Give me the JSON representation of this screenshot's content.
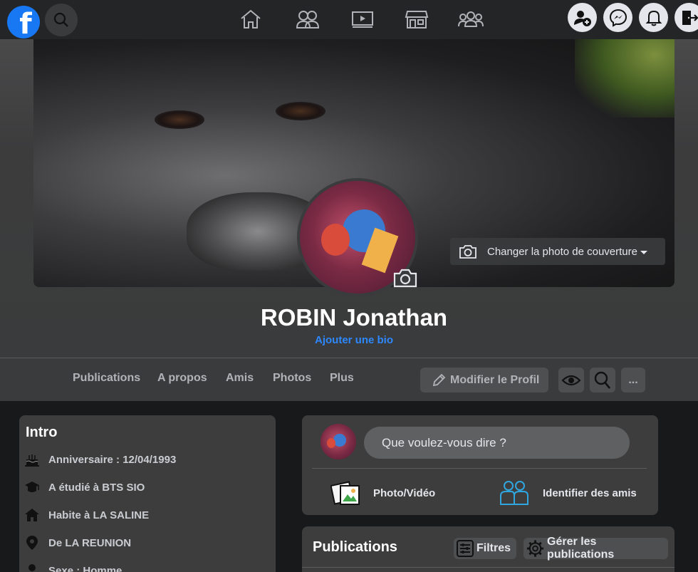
{
  "nav": {
    "logo_letter": "f",
    "icons": [
      "home-icon",
      "friends-icon",
      "watch-icon",
      "marketplace-icon",
      "groups-icon"
    ],
    "right_icons": [
      "add-friend-icon",
      "messenger-icon",
      "notifications-icon",
      "logout-icon"
    ]
  },
  "cover": {
    "change_label": "Changer la photo de couverture"
  },
  "profile": {
    "name": "ROBIN Jonathan",
    "add_bio": "Ajouter une bio"
  },
  "tabs": [
    "Publications",
    "A propos",
    "Amis",
    "Photos",
    "Plus"
  ],
  "actions": {
    "edit_profile": "Modifier le Profil",
    "more": "..."
  },
  "intro": {
    "title": "Intro",
    "items": [
      {
        "icon": "cake-icon",
        "text": "Anniversaire : 12/04/1993"
      },
      {
        "icon": "graduation-icon",
        "text": "A étudié à BTS SIO"
      },
      {
        "icon": "house-icon",
        "text": "Habite à LA SALINE"
      },
      {
        "icon": "location-pin-icon",
        "text": "De LA REUNION"
      },
      {
        "icon": "person-icon",
        "text": "Sexe : Homme"
      }
    ]
  },
  "composer": {
    "placeholder": "Que voulez-vous dire ?",
    "photo_video": "Photo/Vidéo",
    "tag_friends": "Identifier des amis"
  },
  "publications": {
    "title": "Publications",
    "filters": "Filtres",
    "manage": "Gérer les publications"
  },
  "colors": {
    "accent": "#1877f2",
    "link": "#2d88ff",
    "background": "#18191a",
    "card": "#3e3d3e"
  }
}
